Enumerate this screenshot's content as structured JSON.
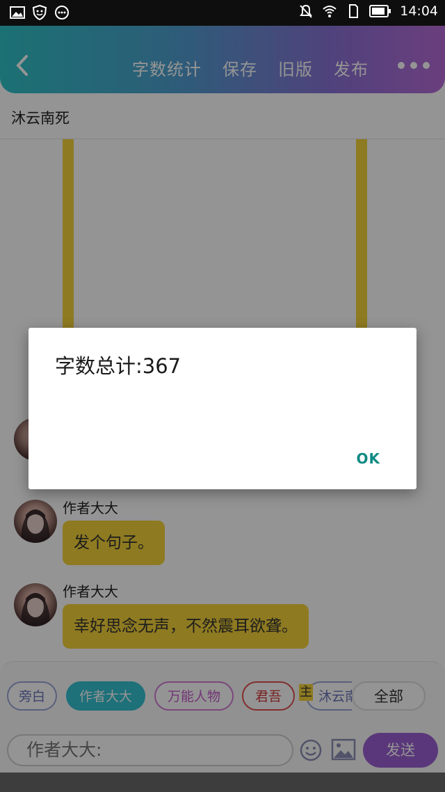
{
  "status_bar": {
    "time": "14:04",
    "left_icons": [
      "image-icon",
      "shield-face-icon",
      "chat-dots-icon"
    ],
    "right_icons": [
      "mute-icon",
      "wifi-icon",
      "sim-icon",
      "battery-icon"
    ]
  },
  "header": {
    "actions": [
      "字数统计",
      "保存",
      "旧版",
      "发布"
    ],
    "gradient_colors": [
      "#2fc3c8",
      "#8b72d6",
      "#b86cd8"
    ]
  },
  "page_title": "沐云南死",
  "messages": [
    {
      "author": "作者大大",
      "text": "发个句子。"
    },
    {
      "author": "作者大大",
      "text": "幸好思念无声，不然震耳欲聋。"
    }
  ],
  "role_chips": [
    "旁白",
    "作者大大",
    "万能人物",
    "君吾",
    "沐云南"
  ],
  "role_chip_active": "作者大大",
  "main_mark": "主",
  "all_chip": "全部",
  "composer": {
    "placeholder": "作者大大:",
    "send_label": "发送"
  },
  "dialog": {
    "message": "字数总计:367",
    "ok_label": "OK",
    "accent_color": "#0f8a85"
  },
  "colors": {
    "bubble": "#f4d23a",
    "send": "#9b5fd2",
    "active_chip": "#34c2d0"
  }
}
